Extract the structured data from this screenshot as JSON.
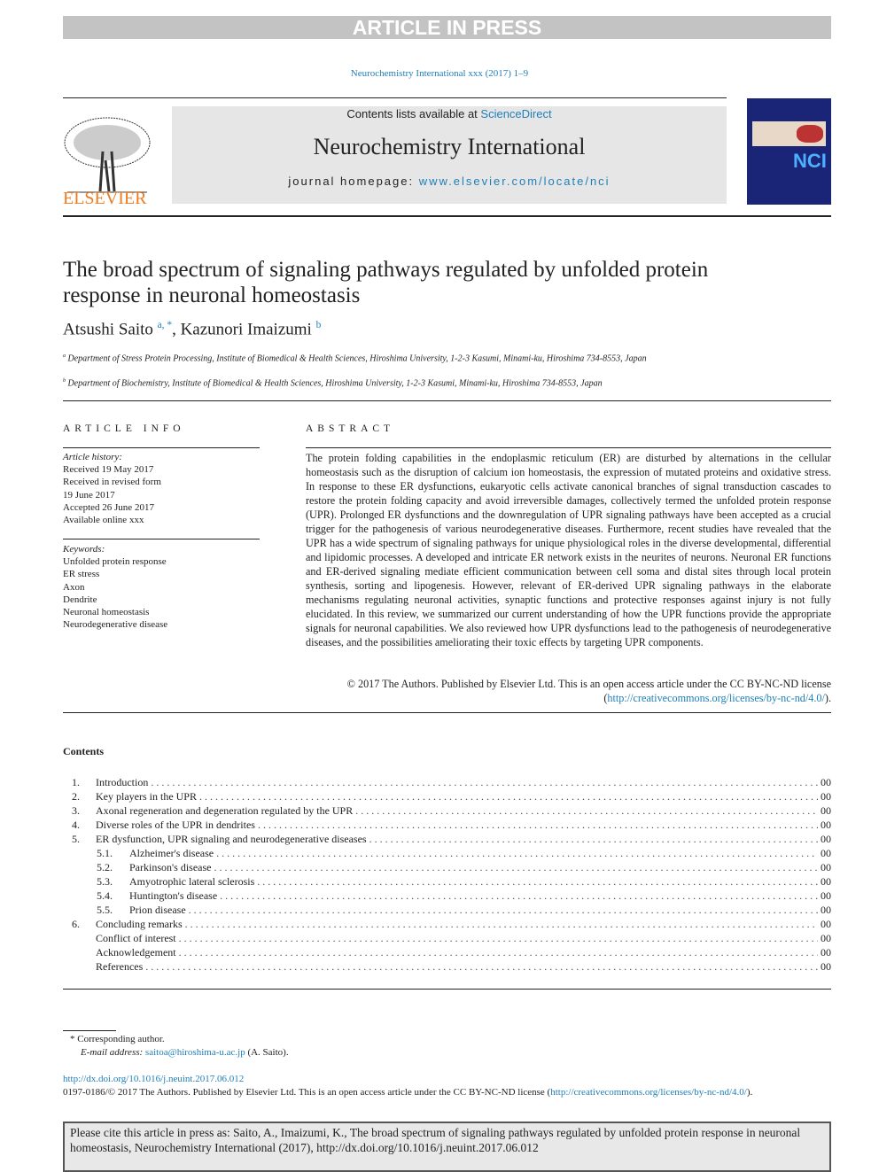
{
  "banner": "ARTICLE IN PRESS",
  "journal_ref": "Neurochemistry International xxx (2017) 1–9",
  "header": {
    "publisher": "ELSEVIER",
    "contents_prefix": "Contents lists available at ",
    "contents_link": "ScienceDirect",
    "journal_title": "Neurochemistry International",
    "homepage_prefix": "journal homepage: ",
    "homepage_link": "www.elsevier.com/locate/nci",
    "cover_text": "NCI"
  },
  "title": "The broad spectrum of signaling pathways regulated by unfolded protein response in neuronal homeostasis",
  "authors": [
    {
      "name": "Atsushi Saito",
      "sup": "a, *"
    },
    {
      "name": "Kazunori Imaizumi",
      "sup": "b"
    }
  ],
  "affiliations": [
    {
      "mark": "a",
      "text": "Department of Stress Protein Processing, Institute of Biomedical & Health Sciences, Hiroshima University, 1-2-3 Kasumi, Minami-ku, Hiroshima 734-8553, Japan"
    },
    {
      "mark": "b",
      "text": "Department of Biochemistry, Institute of Biomedical & Health Sciences, Hiroshima University, 1-2-3 Kasumi, Minami-ku, Hiroshima 734-8553, Japan"
    }
  ],
  "article_info": {
    "heading": "ARTICLE INFO",
    "history_label": "Article history:",
    "history": [
      "Received 19 May 2017",
      "Received in revised form",
      "19 June 2017",
      "Accepted 26 June 2017",
      "Available online xxx"
    ],
    "keywords_label": "Keywords:",
    "keywords": [
      "Unfolded protein response",
      "ER stress",
      "Axon",
      "Dendrite",
      "Neuronal homeostasis",
      "Neurodegenerative disease"
    ]
  },
  "abstract": {
    "heading": "ABSTRACT",
    "text": "The protein folding capabilities in the endoplasmic reticulum (ER) are disturbed by alternations in the cellular homeostasis such as the disruption of calcium ion homeostasis, the expression of mutated proteins and oxidative stress. In response to these ER dysfunctions, eukaryotic cells activate canonical branches of signal transduction cascades to restore the protein folding capacity and avoid irreversible damages, collectively termed the unfolded protein response (UPR). Prolonged ER dysfunctions and the downregulation of UPR signaling pathways have been accepted as a crucial trigger for the pathogenesis of various neurodegenerative diseases. Furthermore, recent studies have revealed that the UPR has a wide spectrum of signaling pathways for unique physiological roles in the diverse developmental, differential and lipidomic processes. A developed and intricate ER network exists in the neurites of neurons. Neuronal ER functions and ER-derived signaling mediate efficient communication between cell soma and distal sites through local protein synthesis, sorting and lipogenesis. However, relevant of ER-derived UPR signaling pathways in the elaborate mechanisms regulating neuronal activities, synaptic functions and protective responses against injury is not fully elucidated. In this review, we summarized our current understanding of how the UPR functions provide the appropriate signals for neuronal capabilities. We also reviewed how UPR dysfunctions lead to the pathogenesis of neurodegenerative diseases, and the possibilities ameliorating their toxic effects by targeting UPR components.",
    "copyright": "© 2017 The Authors. Published by Elsevier Ltd. This is an open access article under the CC BY-NC-ND license (",
    "license_link": "http://creativecommons.org/licenses/by-nc-nd/4.0/",
    "copyright_end": ")."
  },
  "contents": {
    "heading": "Contents",
    "items": [
      {
        "num": "1.",
        "label": "Introduction",
        "page": "00",
        "sub": false
      },
      {
        "num": "2.",
        "label": "Key players in the UPR",
        "page": "00",
        "sub": false
      },
      {
        "num": "3.",
        "label": "Axonal regeneration and degeneration regulated by the UPR",
        "page": "00",
        "sub": false
      },
      {
        "num": "4.",
        "label": "Diverse roles of the UPR in dendrites",
        "page": "00",
        "sub": false
      },
      {
        "num": "5.",
        "label": "ER dysfunction, UPR signaling and neurodegenerative diseases",
        "page": "00",
        "sub": false
      },
      {
        "num": "5.1.",
        "label": "Alzheimer's disease",
        "page": "00",
        "sub": true
      },
      {
        "num": "5.2.",
        "label": "Parkinson's disease",
        "page": "00",
        "sub": true
      },
      {
        "num": "5.3.",
        "label": "Amyotrophic lateral sclerosis",
        "page": "00",
        "sub": true
      },
      {
        "num": "5.4.",
        "label": "Huntington's disease",
        "page": "00",
        "sub": true
      },
      {
        "num": "5.5.",
        "label": "Prion disease",
        "page": "00",
        "sub": true
      },
      {
        "num": "6.",
        "label": "Concluding remarks",
        "page": "00",
        "sub": false
      },
      {
        "num": "",
        "label": "Conflict of interest",
        "page": "00",
        "sub": false
      },
      {
        "num": "",
        "label": "Acknowledgement",
        "page": "00",
        "sub": false
      },
      {
        "num": "",
        "label": "References",
        "page": "00",
        "sub": false
      }
    ]
  },
  "footnotes": {
    "corresponding": "* Corresponding author.",
    "email_label": "E-mail address:",
    "email": "saitoa@hiroshima-u.ac.jp",
    "email_name": "(A. Saito).",
    "doi": "http://dx.doi.org/10.1016/j.neuint.2017.06.012",
    "issn_text": "0197-0186/© 2017 The Authors. Published by Elsevier Ltd. This is an open access article under the CC BY-NC-ND license (",
    "license_link": "http://creativecommons.org/licenses/by-nc-nd/4.0/",
    "issn_end": ")."
  },
  "citation": "Please cite this article in press as: Saito, A., Imaizumi, K., The broad spectrum of signaling pathways regulated by unfolded protein response in neuronal homeostasis, Neurochemistry International (2017), http://dx.doi.org/10.1016/j.neuint.2017.06.012"
}
